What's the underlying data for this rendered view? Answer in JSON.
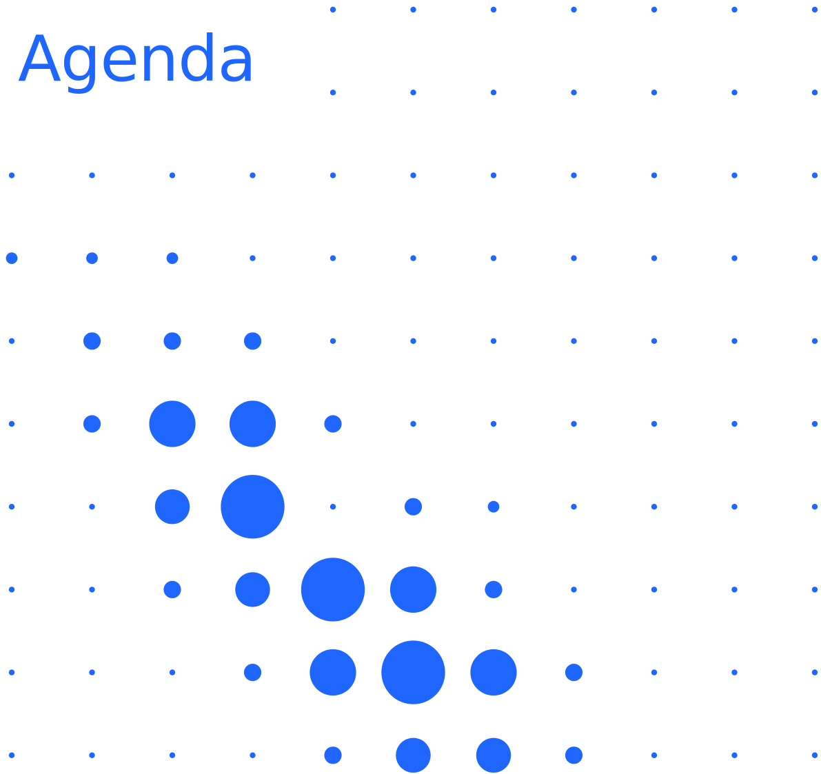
{
  "title": "Agenda",
  "accent_color": "#1F66FF",
  "background_color": "#FFFFFF",
  "dot_pattern": {
    "rows": 10,
    "columns": 11,
    "dot_size_levels": [
      [
        0,
        0,
        0,
        0,
        1,
        1,
        1,
        1,
        1,
        1,
        1
      ],
      [
        0,
        0,
        0,
        0,
        1,
        1,
        1,
        1,
        1,
        1,
        1
      ],
      [
        1,
        1,
        1,
        1,
        1,
        1,
        1,
        1,
        1,
        1,
        1
      ],
      [
        2,
        2,
        2,
        1,
        1,
        1,
        1,
        1,
        1,
        1,
        1
      ],
      [
        1,
        3,
        3,
        3,
        1,
        1,
        1,
        1,
        1,
        1,
        1
      ],
      [
        1,
        3,
        8,
        8,
        3,
        1,
        1,
        1,
        1,
        1,
        1
      ],
      [
        1,
        1,
        6,
        11,
        1,
        3,
        2,
        1,
        1,
        1,
        1
      ],
      [
        1,
        1,
        3,
        6,
        11,
        8,
        3,
        1,
        1,
        1,
        1
      ],
      [
        1,
        1,
        1,
        3,
        8,
        11,
        8,
        3,
        1,
        1,
        1
      ],
      [
        1,
        1,
        1,
        1,
        3,
        6,
        6,
        3,
        1,
        1,
        1
      ]
    ]
  }
}
